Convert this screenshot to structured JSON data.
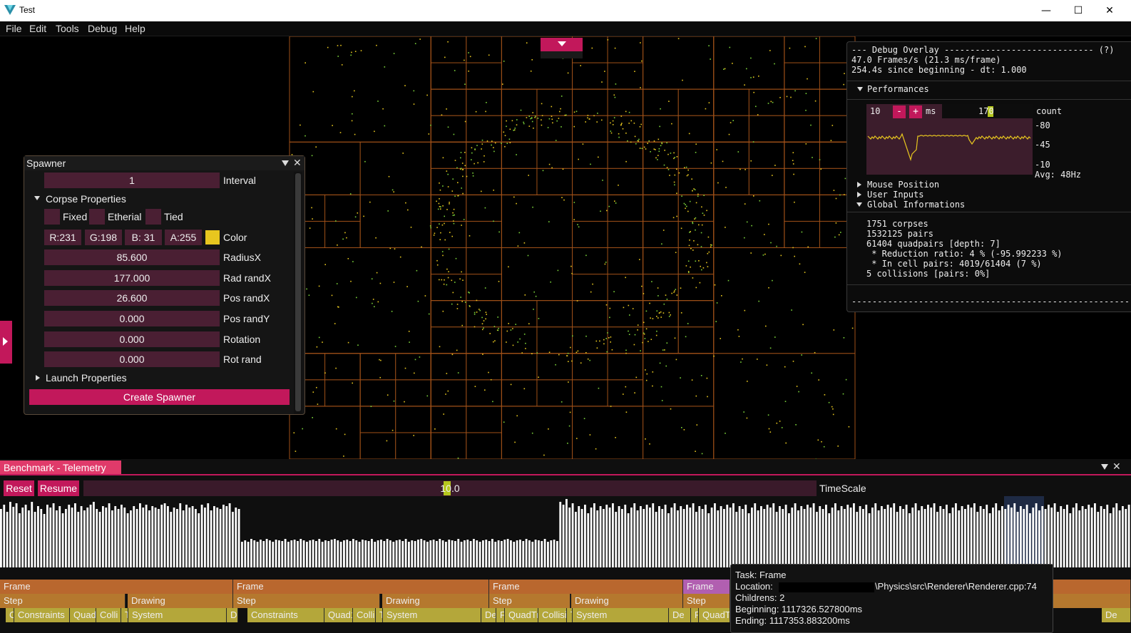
{
  "window": {
    "title": "Test"
  },
  "menu": [
    "File",
    "Edit",
    "Tools",
    "Debug",
    "Help"
  ],
  "spawner": {
    "title": "Spawner",
    "interval": {
      "value": "1",
      "label": "Interval"
    },
    "corpse_section": "Corpse Properties",
    "checks": [
      "Fixed",
      "Etherial",
      "Tied"
    ],
    "color": {
      "r": "R:231",
      "g": "G:198",
      "b": "B: 31",
      "a": "A:255",
      "label": "Color",
      "swatch": "#e7c61f"
    },
    "fields": [
      {
        "value": "85.600",
        "label": "RadiusX"
      },
      {
        "value": "177.000",
        "label": "Rad randX"
      },
      {
        "value": "26.600",
        "label": "Pos randX"
      },
      {
        "value": "0.000",
        "label": "Pos randY"
      },
      {
        "value": "0.000",
        "label": "Rotation"
      },
      {
        "value": "0.000",
        "label": "Rot rand"
      }
    ],
    "launch_section": "Launch Properties",
    "create_button": "Create Spawner"
  },
  "debug": {
    "header": "--- Debug Overlay ----------------------------- (?)",
    "fps": "47.0 Frames/s (21.3 ms/frame)",
    "elapsed": "254.4s since beginning - dt: 1.000",
    "performances": "Performances",
    "perf": {
      "min": "10",
      "minus": "-",
      "plus": "+",
      "unit": "ms",
      "max": "170",
      "count": "count",
      "t80": "-80",
      "t45": "-45",
      "t10": "-10",
      "avg": "Avg: 48Hz"
    },
    "sections": [
      "Mouse Position",
      "User Inputs",
      "Global Informations"
    ],
    "global": [
      "1751 corpses",
      "1532125 pairs",
      "61404 quadpairs [depth: 7]",
      " * Reduction ratio: 4 % (-95.992233 %)",
      " * In cell pairs: 4019/61404 (7 %)",
      "5 collisions [pairs: 0%]"
    ],
    "footer": "--------------------------------------------------------"
  },
  "telemetry": {
    "tab": "Benchmark - Telemetry",
    "reset": "Reset",
    "resume": "Resume",
    "timescale_value": "10.0",
    "timescale_label": "TimeScale",
    "timeline": {
      "row1": [
        {
          "text": "Frame",
          "start": 0,
          "end": 327
        },
        {
          "text": "Frame",
          "start": 327,
          "end": 686
        },
        {
          "text": "Frame",
          "start": 686,
          "end": 958
        },
        {
          "text": "Frame",
          "start": 958,
          "end": 1024,
          "highlight": true
        },
        {
          "text": "",
          "start": 1477,
          "end": 1586
        }
      ],
      "row2": [
        {
          "text": "Step",
          "start": 0,
          "end": 176
        },
        {
          "text": "Drawing",
          "start": 179,
          "end": 327
        },
        {
          "text": "Step",
          "start": 327,
          "end": 533
        },
        {
          "text": "Drawing",
          "start": 536,
          "end": 686
        },
        {
          "text": "Step",
          "start": 686,
          "end": 800
        },
        {
          "text": "Drawing",
          "start": 801,
          "end": 958
        },
        {
          "text": "Step",
          "start": 958,
          "end": 1024
        },
        {
          "text": "",
          "start": 1477,
          "end": 1586
        }
      ],
      "row3": [
        {
          "text": "C",
          "start": 8,
          "end": 20
        },
        {
          "text": "Constraints",
          "start": 20,
          "end": 98
        },
        {
          "text": "Quad1",
          "start": 98,
          "end": 135
        },
        {
          "text": "Colli",
          "start": 135,
          "end": 170
        },
        {
          "text": "T",
          "start": 170,
          "end": 180
        },
        {
          "text": "System",
          "start": 180,
          "end": 318
        },
        {
          "text": "De",
          "start": 318,
          "end": 334
        },
        {
          "text": "Constraints",
          "start": 347,
          "end": 455
        },
        {
          "text": "Quad1",
          "start": 455,
          "end": 495
        },
        {
          "text": "Colli",
          "start": 495,
          "end": 527
        },
        {
          "text": "T",
          "start": 527,
          "end": 537
        },
        {
          "text": "System",
          "start": 537,
          "end": 675
        },
        {
          "text": "De",
          "start": 675,
          "end": 696
        },
        {
          "text": "F",
          "start": 696,
          "end": 708
        },
        {
          "text": "QuadTr",
          "start": 708,
          "end": 755
        },
        {
          "text": "Collisi",
          "start": 755,
          "end": 795
        },
        {
          "text": "T",
          "start": 795,
          "end": 803
        },
        {
          "text": "System",
          "start": 803,
          "end": 938
        },
        {
          "text": "De",
          "start": 938,
          "end": 969
        },
        {
          "text": "F",
          "start": 969,
          "end": 980
        },
        {
          "text": "QuadT",
          "start": 980,
          "end": 1024
        },
        {
          "text": "De",
          "start": 1545,
          "end": 1586
        }
      ]
    },
    "tooltip": {
      "task": "Task: Frame",
      "location_label": "Location:",
      "location_path": "\\Physics\\src\\Renderer\\Renderer.cpp:74",
      "childrens": "Childrens: 2",
      "beginning": "Beginning: 1117326.527800ms",
      "ending": "Ending: 1117353.883200ms"
    },
    "frame_bars": [
      82,
      88,
      78,
      92,
      85,
      90,
      76,
      84,
      88,
      80,
      92,
      78,
      86,
      82,
      75,
      88,
      84,
      90,
      80,
      86,
      76,
      82,
      88,
      84,
      90,
      78,
      86,
      80,
      84,
      88,
      92,
      82,
      78,
      86,
      84,
      90,
      80,
      86,
      82,
      88,
      84,
      76,
      80,
      86,
      82,
      90,
      84,
      88,
      80,
      86,
      84,
      82,
      88,
      90,
      86,
      78,
      84,
      82,
      90,
      80,
      88,
      84,
      86,
      82,
      76,
      88,
      84,
      90,
      80,
      86,
      84,
      82,
      88,
      86,
      90,
      78,
      84,
      82,
      36,
      38,
      36,
      40,
      38,
      36,
      39,
      37,
      40,
      38,
      36,
      39,
      38,
      37,
      40,
      36,
      38,
      39,
      37,
      40,
      38,
      36,
      38,
      39,
      37,
      40,
      36,
      38,
      37,
      39,
      40,
      38,
      36,
      38,
      39,
      37,
      40,
      38,
      36,
      39,
      38,
      37,
      40,
      36,
      38,
      39,
      37,
      40,
      38,
      36,
      38,
      39,
      37,
      40,
      36,
      38,
      37,
      39,
      40,
      38,
      36,
      38,
      39,
      37,
      40,
      38,
      36,
      39,
      38,
      37,
      40,
      36,
      38,
      39,
      37,
      40,
      38,
      36,
      38,
      39,
      37,
      40,
      36,
      38,
      37,
      39,
      40,
      38,
      36,
      38,
      39,
      37,
      40,
      38,
      36,
      39,
      38,
      37,
      40,
      36,
      38,
      39,
      37,
      92,
      88,
      96,
      84,
      90,
      78,
      86,
      82,
      88,
      76,
      84,
      90,
      80,
      86,
      82,
      88,
      84,
      90,
      78,
      86,
      82,
      88,
      76,
      84,
      90,
      80,
      86,
      82,
      88,
      84,
      90,
      78,
      86,
      82,
      88,
      76,
      84,
      90,
      80,
      86,
      82,
      88,
      84,
      90,
      78,
      86,
      82,
      88,
      76,
      84,
      90,
      80,
      86,
      82,
      88,
      84,
      90,
      78,
      86,
      82,
      88,
      76,
      84,
      90,
      80,
      86,
      82,
      88,
      84,
      90,
      78,
      86,
      82,
      88,
      76,
      84,
      90,
      80,
      86,
      82,
      88,
      84,
      90,
      78,
      86,
      82,
      88,
      76,
      84,
      90,
      80,
      86,
      82,
      88,
      84,
      90,
      78,
      86,
      82,
      88,
      76,
      84,
      90,
      80,
      86,
      82,
      88,
      84,
      90,
      78,
      86,
      82,
      88,
      76,
      84,
      90,
      80,
      86,
      82,
      88,
      84,
      90,
      78,
      86,
      82,
      88,
      76,
      84,
      90,
      80,
      86,
      82,
      88,
      84,
      90,
      78,
      86,
      82,
      88,
      76,
      84,
      90,
      80,
      86,
      82,
      88,
      84,
      90,
      78,
      86,
      82,
      88,
      76,
      84,
      90,
      80,
      86,
      82,
      88,
      84,
      90,
      78,
      86,
      82,
      88,
      76,
      84,
      90,
      80,
      86,
      82,
      88,
      84,
      90,
      78,
      86,
      82,
      88,
      76,
      84,
      90,
      80,
      86,
      82,
      88
    ]
  },
  "colors": {
    "accent": "#c2185b",
    "frame": "#b9672e",
    "step": "#b5782e",
    "system": "#b4a73a",
    "grid": "#a0521a",
    "particle": "#e7c61f"
  }
}
